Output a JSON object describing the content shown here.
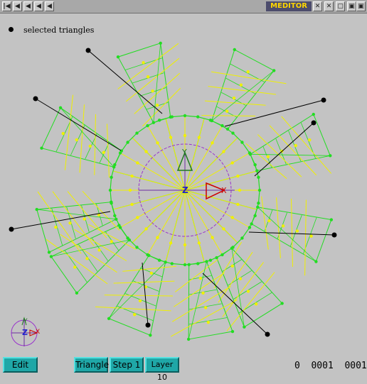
{
  "window": {
    "title": "MEDITOR",
    "left_controls": [
      "⇤",
      "◀",
      "◀",
      "◀",
      "◀"
    ],
    "right_controls": [
      "✕",
      "▢",
      "▣"
    ]
  },
  "legend": {
    "label": "selected triangles"
  },
  "axes": {
    "y_label": "Y",
    "x_label": "X",
    "z_label": "Z"
  },
  "buttons": {
    "edit": "Edit",
    "triangle": "Triangle",
    "step": "Step 1",
    "layer": "Layer 10"
  },
  "status": {
    "text": "0  0001  0001"
  },
  "colors": {
    "mesh_green": "#22dd22",
    "edge_yellow": "#f0f000",
    "callout_black": "#000000",
    "circle_magenta": "#9933cc",
    "button_cyan": "#1fa7a7",
    "z_blue": "#2222cc",
    "x_red": "#cc0000"
  }
}
